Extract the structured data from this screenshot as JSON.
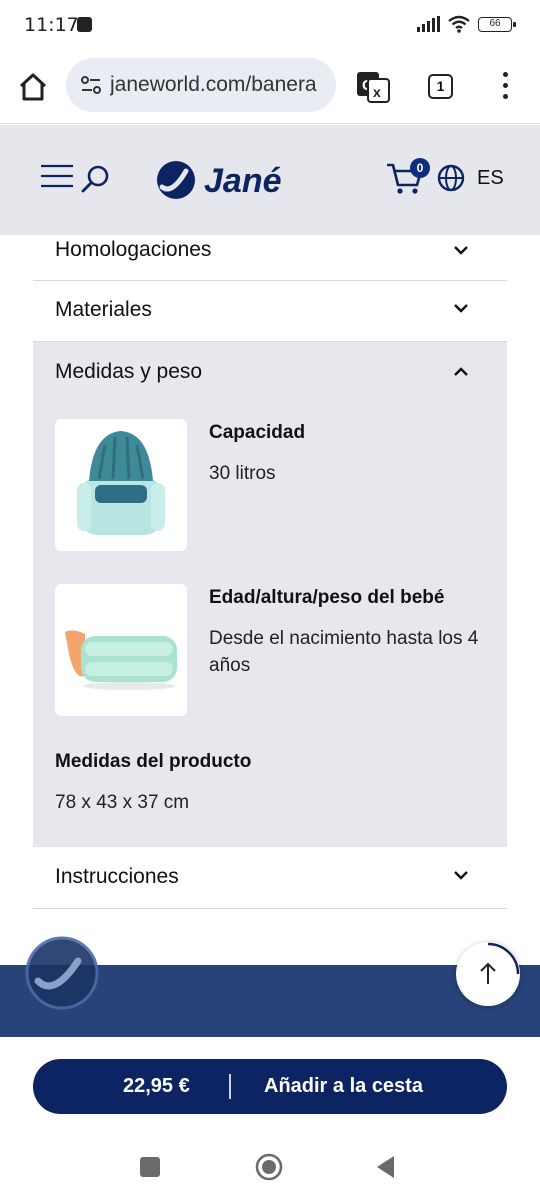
{
  "status": {
    "time": "11:17",
    "battery": "66"
  },
  "browser": {
    "url": "janeworld.com/banera",
    "tab_count": "1"
  },
  "header": {
    "cart_count": "0",
    "language": "ES",
    "logo_text": "Jané"
  },
  "accordion": {
    "homologaciones": "Homologaciones",
    "materiales": "Materiales",
    "medidas": "Medidas y peso",
    "instrucciones": "Instrucciones"
  },
  "specs": {
    "capacidad_title": "Capacidad",
    "capacidad_value": "30 litros",
    "edad_title": "Edad/altura/peso del bebé",
    "edad_value": "Desde el nacimiento hasta los 4 años",
    "medidas_title": "Medidas del producto",
    "medidas_value": "78 x 43 x 37 cm"
  },
  "buy": {
    "price": "22,95 €",
    "cta": "Añadir a la cesta"
  },
  "colors": {
    "brand": "#0c2461",
    "header_bg": "#e5e7ec",
    "footer": "#284379"
  }
}
